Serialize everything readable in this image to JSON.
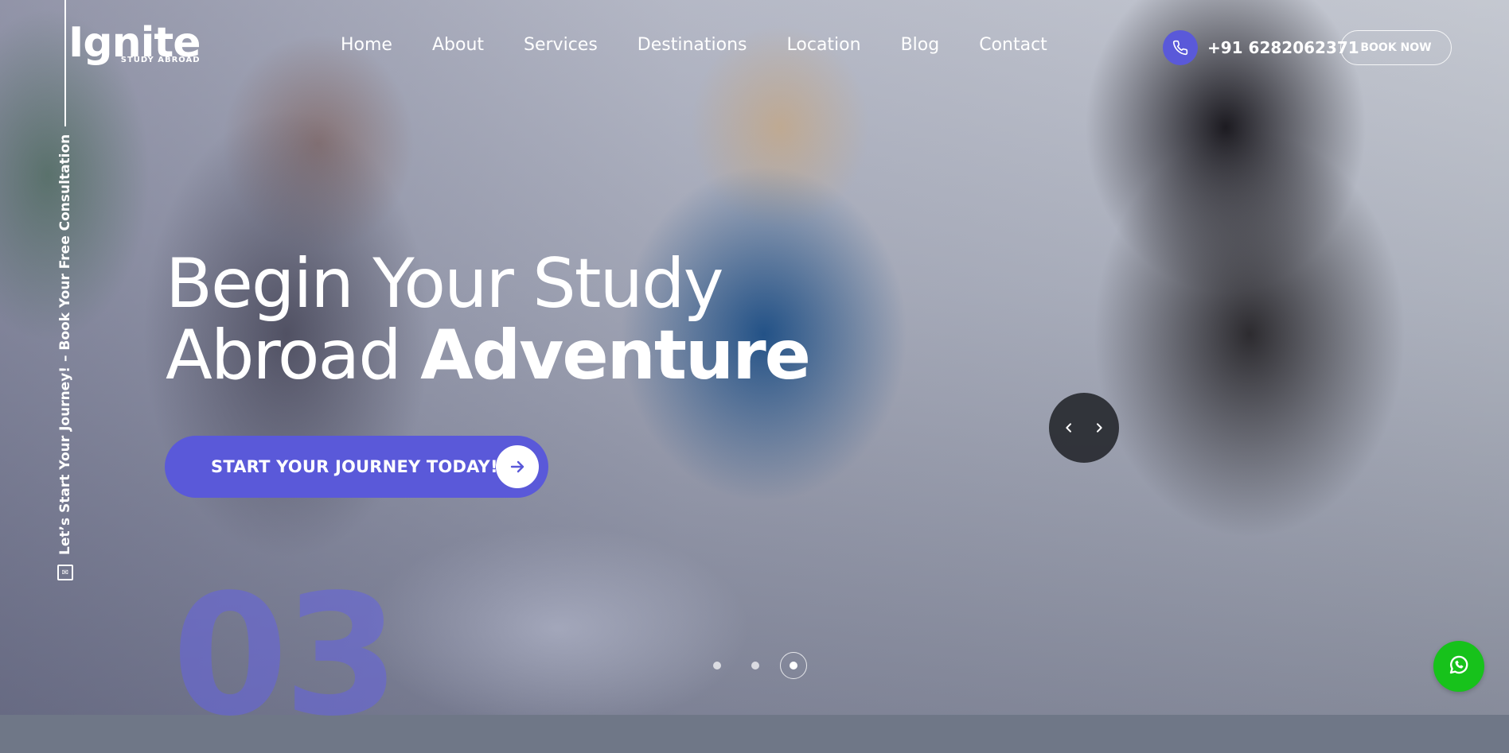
{
  "brand": {
    "name": "Ignite",
    "tagline": "STUDY ABROAD"
  },
  "nav": {
    "items": [
      {
        "label": "Home"
      },
      {
        "label": "About"
      },
      {
        "label": "Services"
      },
      {
        "label": "Destinations"
      },
      {
        "label": "Location"
      },
      {
        "label": "Blog"
      },
      {
        "label": "Contact"
      }
    ]
  },
  "contact": {
    "phone": "+91 6282062371",
    "phone_icon": "phone-icon"
  },
  "header": {
    "book_now_label": "BOOK NOW"
  },
  "side_cta": {
    "text": "Let’s Start Your Journey! – Book Your Free Consultation",
    "icon": "mail-icon"
  },
  "hero": {
    "headline_line1": "Begin Your Study",
    "headline_line2_regular": "Abroad",
    "headline_line2_bold": "Adventure",
    "cta_label": "START YOUR JOURNEY TODAY!",
    "cta_icon": "arrow-right-icon",
    "slide_number": "03"
  },
  "slider": {
    "total_slides": 3,
    "active_slide": 3
  },
  "colors": {
    "accent": "#5a59d9",
    "whatsapp": "#17c21b",
    "slider_nav": "#2a2c31"
  }
}
